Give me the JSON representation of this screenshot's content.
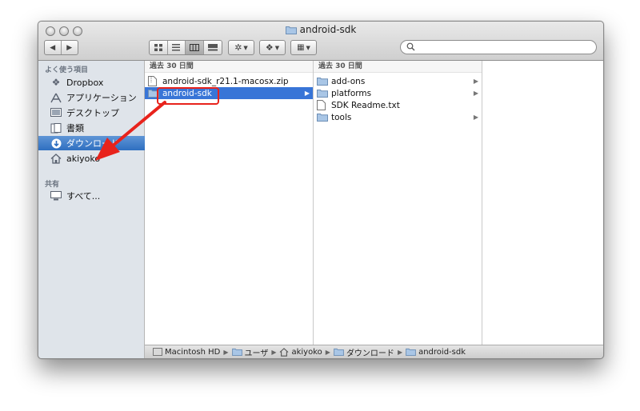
{
  "window": {
    "title": "android-sdk"
  },
  "toolbar": {
    "back_icon": "◀",
    "forward_icon": "▶",
    "view_icons": [
      "icon-view-icon",
      "list-view-icon",
      "column-view-icon",
      "coverflow-view-icon"
    ],
    "action_menu": "gear-icon",
    "dropbox_menu": "dropbox-icon",
    "arrange_menu": "arrange-icon"
  },
  "search": {
    "placeholder": ""
  },
  "sidebar": {
    "favorites_header": "よく使う項目",
    "items": [
      {
        "label": "Dropbox",
        "icon": "dropbox-icon"
      },
      {
        "label": "アプリケーション",
        "icon": "applications-icon"
      },
      {
        "label": "デスクトップ",
        "icon": "desktop-icon"
      },
      {
        "label": "書類",
        "icon": "documents-icon"
      },
      {
        "label": "ダウンロード",
        "icon": "downloads-icon"
      },
      {
        "label": "akiyoko",
        "icon": "home-icon"
      }
    ],
    "shared_header": "共有",
    "shared_items": [
      {
        "label": "すべて...",
        "icon": "network-icon"
      }
    ]
  },
  "columns": [
    {
      "header": "過去 30 日間",
      "rows": [
        {
          "label": "android-sdk_r21.1-macosx.zip",
          "type": "file"
        },
        {
          "label": "android-sdk",
          "type": "folder"
        }
      ]
    },
    {
      "header": "過去 30 日間",
      "rows": [
        {
          "label": "add-ons",
          "type": "folder"
        },
        {
          "label": "platforms",
          "type": "folder"
        },
        {
          "label": "SDK Readme.txt",
          "type": "file"
        },
        {
          "label": "tools",
          "type": "folder"
        }
      ]
    }
  ],
  "pathbar": {
    "items": [
      {
        "label": "Macintosh HD",
        "icon": "drive-icon"
      },
      {
        "label": "ユーザ",
        "icon": "folder-icon"
      },
      {
        "label": "akiyoko",
        "icon": "home-icon"
      },
      {
        "label": "ダウンロード",
        "icon": "folder-icon"
      },
      {
        "label": "android-sdk",
        "icon": "folder-icon"
      }
    ]
  },
  "colors": {
    "selection": "#3875d7",
    "sidebar_selection": "#2f6fc0",
    "annotation_red": "#e8231c"
  }
}
